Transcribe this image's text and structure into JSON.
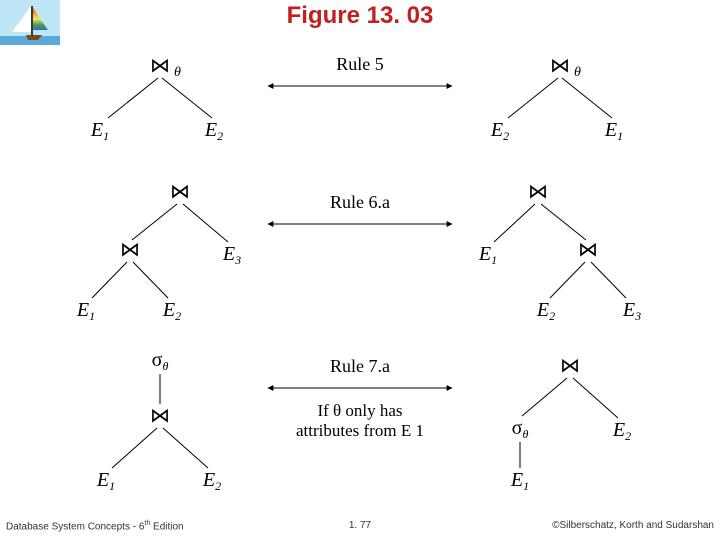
{
  "title": "Figure 13. 03",
  "logo": {
    "semantic": "sailboat"
  },
  "labels": {
    "rule5": "Rule 5",
    "rule6a": "Rule 6.a",
    "rule7a": "Rule 7.a",
    "ifTheta1": "If θ only has",
    "ifTheta2": "attributes from E 1"
  },
  "symbols": {
    "join": "⋈",
    "theta": "θ",
    "sigma": "σ",
    "E1": "E",
    "E1sub": "1",
    "E2": "E",
    "E2sub": "2",
    "E3": "E",
    "E3sub": "3"
  },
  "footer": {
    "left_a": "Database System Concepts - 6",
    "left_sup": "th",
    "left_b": " Edition",
    "center": "1. 77",
    "right": "©Silberschatz, Korth and Sudarshan"
  }
}
